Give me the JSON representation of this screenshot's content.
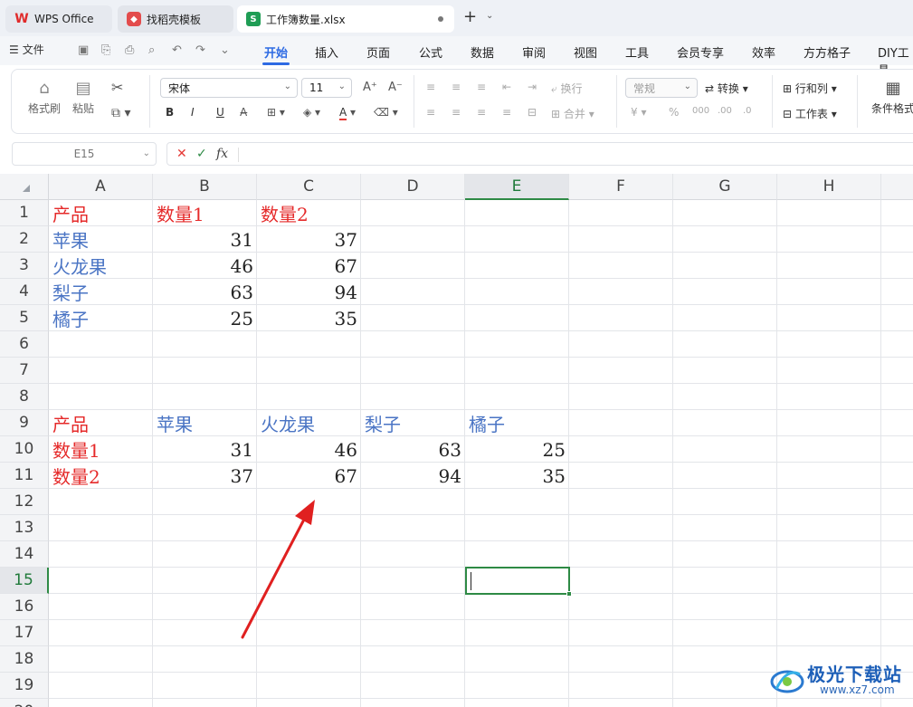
{
  "tabs": [
    {
      "label": "WPS Office"
    },
    {
      "label": "找稻壳模板"
    },
    {
      "label": "工作簿数量.xlsx"
    }
  ],
  "menu": {
    "file": "文件",
    "items": [
      "开始",
      "插入",
      "页面",
      "公式",
      "数据",
      "审阅",
      "视图",
      "工具",
      "会员专享",
      "效率",
      "方方格子",
      "DIY工具"
    ]
  },
  "ribbon": {
    "format_painter": "格式刷",
    "paste": "粘贴",
    "font_name": "宋体",
    "font_size": "11",
    "wrap": "换行",
    "merge": "合并",
    "number_format": "常规",
    "convert": "转换",
    "row_col": "行和列",
    "worksheet": "工作表",
    "cond_format": "条件格式",
    "bold": "B",
    "italic": "I",
    "underline": "U"
  },
  "formula_bar": {
    "name_box": "E15",
    "fx": "fx"
  },
  "columns": [
    "A",
    "B",
    "C",
    "D",
    "E",
    "F",
    "G",
    "H"
  ],
  "rows": [
    "1",
    "2",
    "3",
    "4",
    "5",
    "6",
    "7",
    "8",
    "9",
    "10",
    "11",
    "12",
    "13",
    "14",
    "15",
    "16",
    "17",
    "18",
    "19",
    "20"
  ],
  "table1": {
    "header": [
      "产品",
      "数量1",
      "数量2"
    ],
    "rows": [
      [
        "苹果",
        "31",
        "37"
      ],
      [
        "火龙果",
        "46",
        "67"
      ],
      [
        "梨子",
        "63",
        "94"
      ],
      [
        "橘子",
        "25",
        "35"
      ]
    ]
  },
  "table2": {
    "header": [
      "产品",
      "苹果",
      "火龙果",
      "梨子",
      "橘子"
    ],
    "rows": [
      [
        "数量1",
        "31",
        "46",
        "63",
        "25"
      ],
      [
        "数量2",
        "37",
        "67",
        "94",
        "35"
      ]
    ]
  },
  "watermark": {
    "title": "极光下载站",
    "url": "www.xz7.com"
  }
}
